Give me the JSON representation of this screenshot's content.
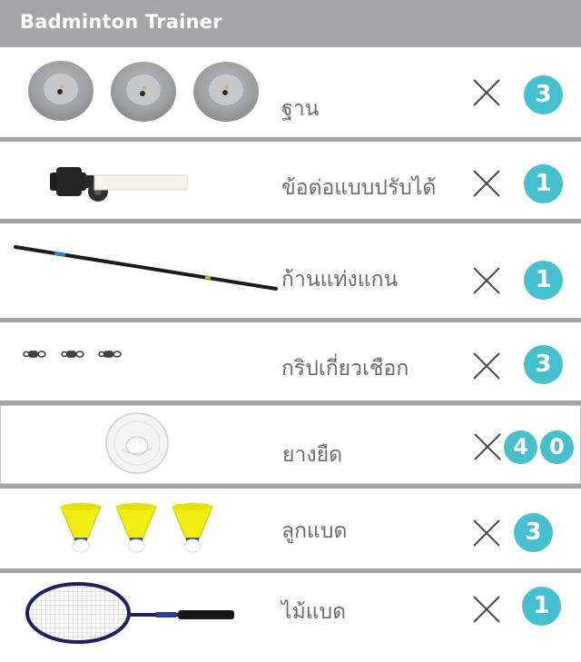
{
  "header": {
    "title": "Badminton Trainer"
  },
  "items": [
    {
      "name": "ฐาน",
      "quantity": "3",
      "icon": "base-disc-icon"
    },
    {
      "name": "ข้อต่อแบบปรับได้",
      "quantity": "1",
      "icon": "adjustable-connector-icon"
    },
    {
      "name": "ก้านแท่งแกน",
      "quantity": "1",
      "icon": "pole-rod-icon"
    },
    {
      "name": "กริปเกี่ยวเชือก",
      "quantity": "3",
      "icon": "swivel-clip-icon"
    },
    {
      "name": "ยางยืด",
      "quantity_digits": [
        "4",
        "0"
      ],
      "icon": "elastic-band-roll-icon"
    },
    {
      "name": "ลูกแบด",
      "quantity": "3",
      "icon": "shuttlecock-icon"
    },
    {
      "name": "ไม้แบด",
      "quantity": "1",
      "icon": "racket-icon"
    }
  ],
  "colors": {
    "header_bg": "#a5a5a7",
    "badge": "#46bfcf",
    "text": "#6a6a6e",
    "separator": "#a4a4a6"
  }
}
